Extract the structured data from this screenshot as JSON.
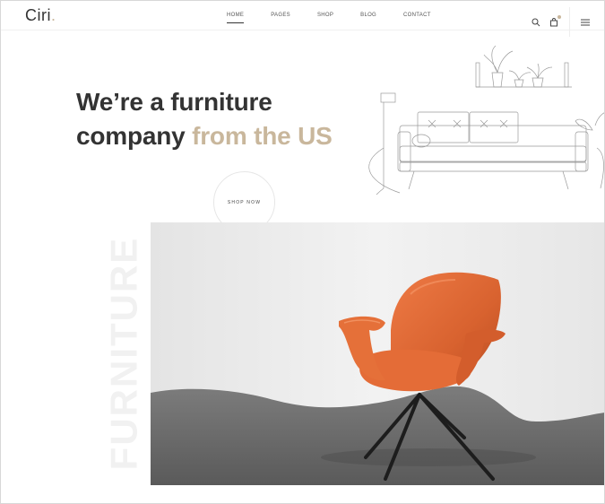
{
  "brand": {
    "logo_text": "Ciri",
    "logo_dot": "."
  },
  "nav": {
    "items": [
      {
        "label": "HOME",
        "active": true
      },
      {
        "label": "PAGES",
        "active": false
      },
      {
        "label": "SHOP",
        "active": false
      },
      {
        "label": "BLOG",
        "active": false
      },
      {
        "label": "CONTACT",
        "active": false
      }
    ]
  },
  "header_icons": [
    "search-icon",
    "cart-icon",
    "menu-icon"
  ],
  "hero": {
    "line1": "We’re a furniture",
    "line2_plain": "company ",
    "line2_accent": "from the US",
    "cta_label": "SHOP NOW"
  },
  "vertical_word": "FURNITURE",
  "colors": {
    "accent": "#c9b79c",
    "text": "#333333",
    "chair_leather": "#d9683a",
    "floor": "#6f6f6f",
    "wall": "#ededed"
  }
}
